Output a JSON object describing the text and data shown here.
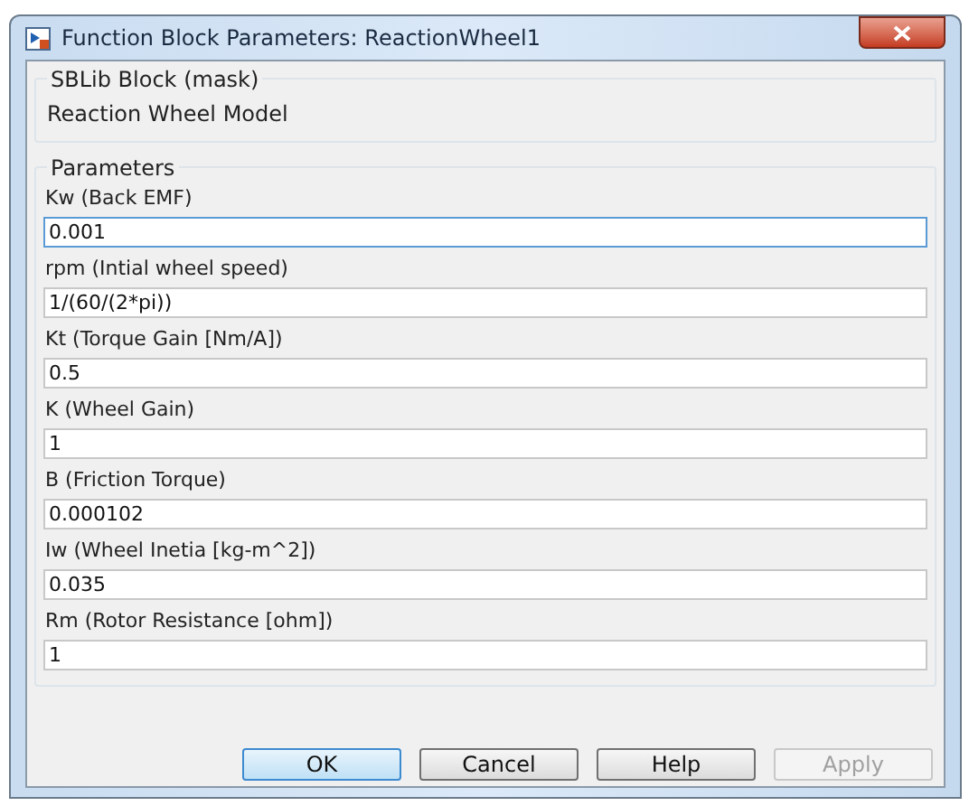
{
  "window": {
    "title": "Function Block Parameters: ReactionWheel1"
  },
  "mask_group": {
    "title": "SBLib Block (mask)",
    "description": "Reaction Wheel Model"
  },
  "parameters_group": {
    "title": "Parameters",
    "fields": [
      {
        "label": "Kw (Back EMF)",
        "value": "0.001",
        "focused": true
      },
      {
        "label": "rpm (Intial wheel speed)",
        "value": "1/(60/(2*pi))",
        "focused": false
      },
      {
        "label": "Kt (Torque Gain [Nm/A])",
        "value": "0.5",
        "focused": false
      },
      {
        "label": "K (Wheel Gain)",
        "value": "1",
        "focused": false
      },
      {
        "label": "B (Friction Torque)",
        "value": "0.000102",
        "focused": false
      },
      {
        "label": "Iw (Wheel Inetia [kg-m^2])",
        "value": "0.035",
        "focused": false
      },
      {
        "label": "Rm (Rotor Resistance [ohm])",
        "value": "1",
        "focused": false
      }
    ]
  },
  "buttons": [
    {
      "label": "OK",
      "default": true,
      "disabled": false
    },
    {
      "label": "Cancel",
      "default": false,
      "disabled": false
    },
    {
      "label": "Help",
      "default": false,
      "disabled": false
    },
    {
      "label": "Apply",
      "default": false,
      "disabled": true
    }
  ]
}
